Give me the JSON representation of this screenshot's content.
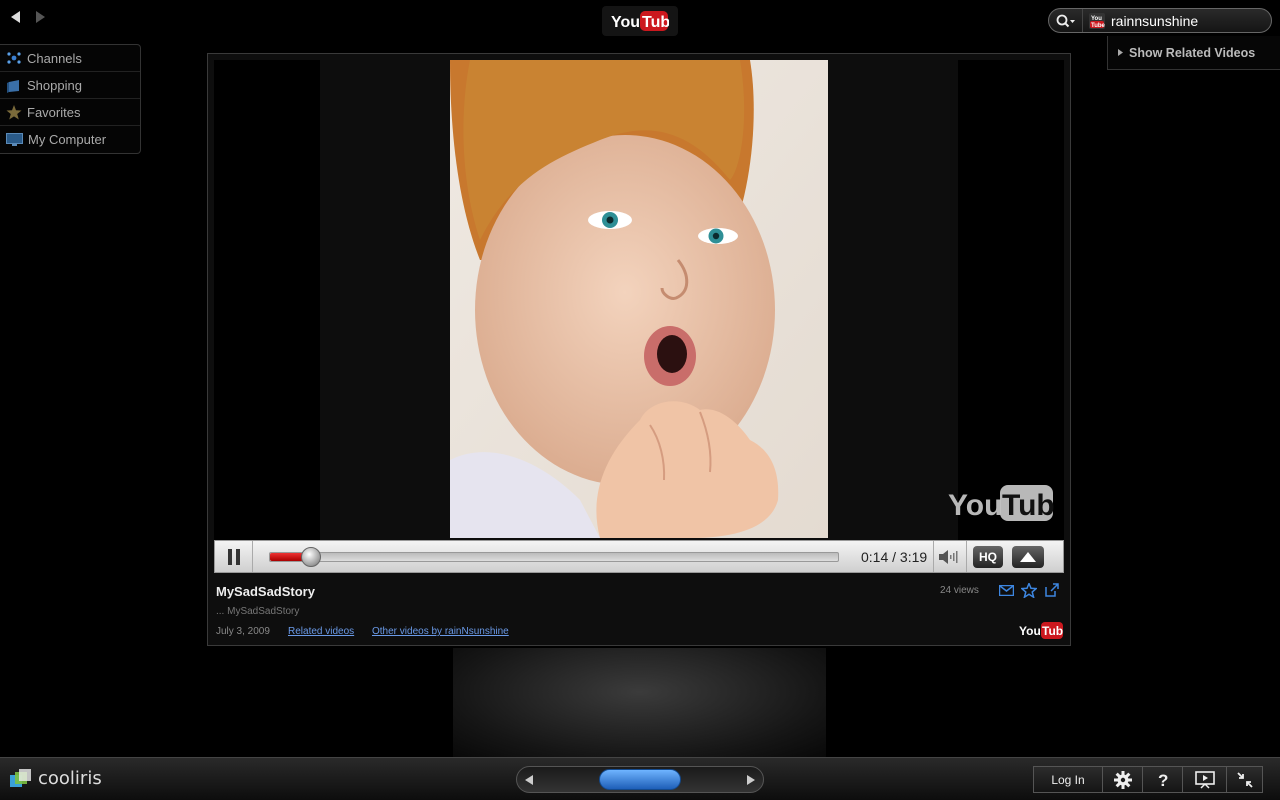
{
  "nav": {
    "back_icon": "back-arrow-icon",
    "forward_icon": "forward-arrow-icon"
  },
  "header": {
    "logo_text": "YouTube"
  },
  "search": {
    "value": "rainnsunshine",
    "source_icon": "youtube-source-icon"
  },
  "related": {
    "label": "Show Related Videos"
  },
  "sidebar": {
    "items": [
      {
        "label": "Channels",
        "icon": "channels-icon"
      },
      {
        "label": "Shopping",
        "icon": "shopping-bag-icon"
      },
      {
        "label": "Favorites",
        "icon": "star-icon"
      },
      {
        "label": "My Computer",
        "icon": "computer-icon"
      }
    ]
  },
  "video": {
    "watermark": "YouTube",
    "time": "0:14 / 3:19",
    "progress_fraction": 0.073,
    "hq_label": "HQ"
  },
  "info": {
    "title": "MySadSadStory",
    "description": "... MySadSadStory",
    "date": "July 3, 2009",
    "related_link": "Related videos",
    "other_link": "Other videos by rainNsunshine",
    "views": "24 views"
  },
  "bottom": {
    "brand": "cooliris",
    "login_label": "Log In"
  },
  "colors": {
    "accent": "#cc181e",
    "link": "#6a9ae8",
    "scroll_handle": "#3c8ae8"
  }
}
